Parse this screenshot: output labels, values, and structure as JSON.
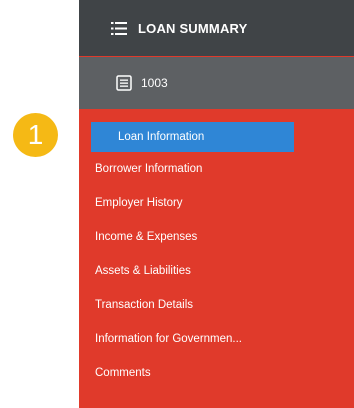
{
  "header": {
    "title": "LOAN SUMMARY",
    "icon": "list-icon"
  },
  "form": {
    "label": "1003",
    "icon": "document-icon"
  },
  "callout": {
    "number": "1",
    "color": "#f5b915"
  },
  "menu": {
    "items": [
      {
        "label": "Loan Information",
        "active": true
      },
      {
        "label": "Borrower Information"
      },
      {
        "label": "Employer History"
      },
      {
        "label": "Income & Expenses"
      },
      {
        "label": "Assets & Liabilities"
      },
      {
        "label": "Transaction Details"
      },
      {
        "label": "Information for Governmen..."
      },
      {
        "label": "Comments"
      }
    ]
  },
  "colors": {
    "header_bg": "#404447",
    "subheader_bg": "#5d6063",
    "menu_bg": "#e03a2b",
    "active_bg": "#2f86d6"
  }
}
